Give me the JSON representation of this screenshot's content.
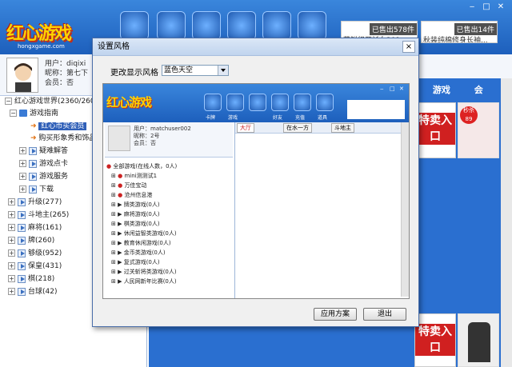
{
  "main": {
    "logo_text": "红心游戏",
    "logo_sub": "hongxgame.com",
    "sales": [
      {
        "tag": "已售出578件",
        "text": "蒲鲜织开衫女201"
      },
      {
        "tag": "已售出14件",
        "text": "秋装纯棉修身长袖..."
      }
    ],
    "user": {
      "line1": "用户：diqixi",
      "line2": "昵称：第七下",
      "line3": "会员：否"
    },
    "right_tabs": [
      "赛",
      "游戏",
      "会"
    ],
    "ads": [
      {
        "text": "特卖入口",
        "badge": "秒杀 89"
      },
      {
        "text": "特卖入口"
      }
    ],
    "tree": [
      {
        "label": "红心游戏世界(2360/260"
      },
      {
        "label": "游戏指南"
      },
      {
        "label": "红心币买会员",
        "selected": true
      },
      {
        "label": "购买形象秀和饰品"
      },
      {
        "label": "疑难解答"
      },
      {
        "label": "游戏点卡"
      },
      {
        "label": "游戏服务"
      },
      {
        "label": "下载"
      },
      {
        "label": "升级(277)"
      },
      {
        "label": "斗地主(265)"
      },
      {
        "label": "麻将(161)"
      },
      {
        "label": "牌(260)"
      },
      {
        "label": "够级(952)"
      },
      {
        "label": "保皇(431)"
      },
      {
        "label": "棋(218)"
      },
      {
        "label": "台球(42)"
      }
    ]
  },
  "dialog": {
    "title": "设置风格",
    "close_glyph": "×",
    "style_label": "更改显示风格",
    "style_value": "蓝色天空",
    "apply_button": "应用方案",
    "exit_button": "退出",
    "preview": {
      "logo_text": "红心游戏",
      "icon_labels": [
        "卡牌",
        "游戏",
        "好友",
        "充值",
        "道具"
      ],
      "user": {
        "line1": "用户：matchuser002",
        "line2": "昵称：2号",
        "line3": "会员：否"
      },
      "tabs": [
        "大厅",
        "在水一方",
        "斗地主"
      ],
      "tree": [
        "全部游戏(在线人数，0人)",
        "mini测测试1",
        "万佳宝动",
        "沧州信息港",
        "牌类游戏(0人)",
        "麻将游戏(0人)",
        "棋类游戏(0人)",
        "休闲益智类游戏(0人)",
        "教育休闲游戏(0人)",
        "金币类游戏(0人)",
        "复式游戏(0人)",
        "过关斩将类游戏(0人)",
        "人民网新年比赛(0人)"
      ]
    }
  }
}
